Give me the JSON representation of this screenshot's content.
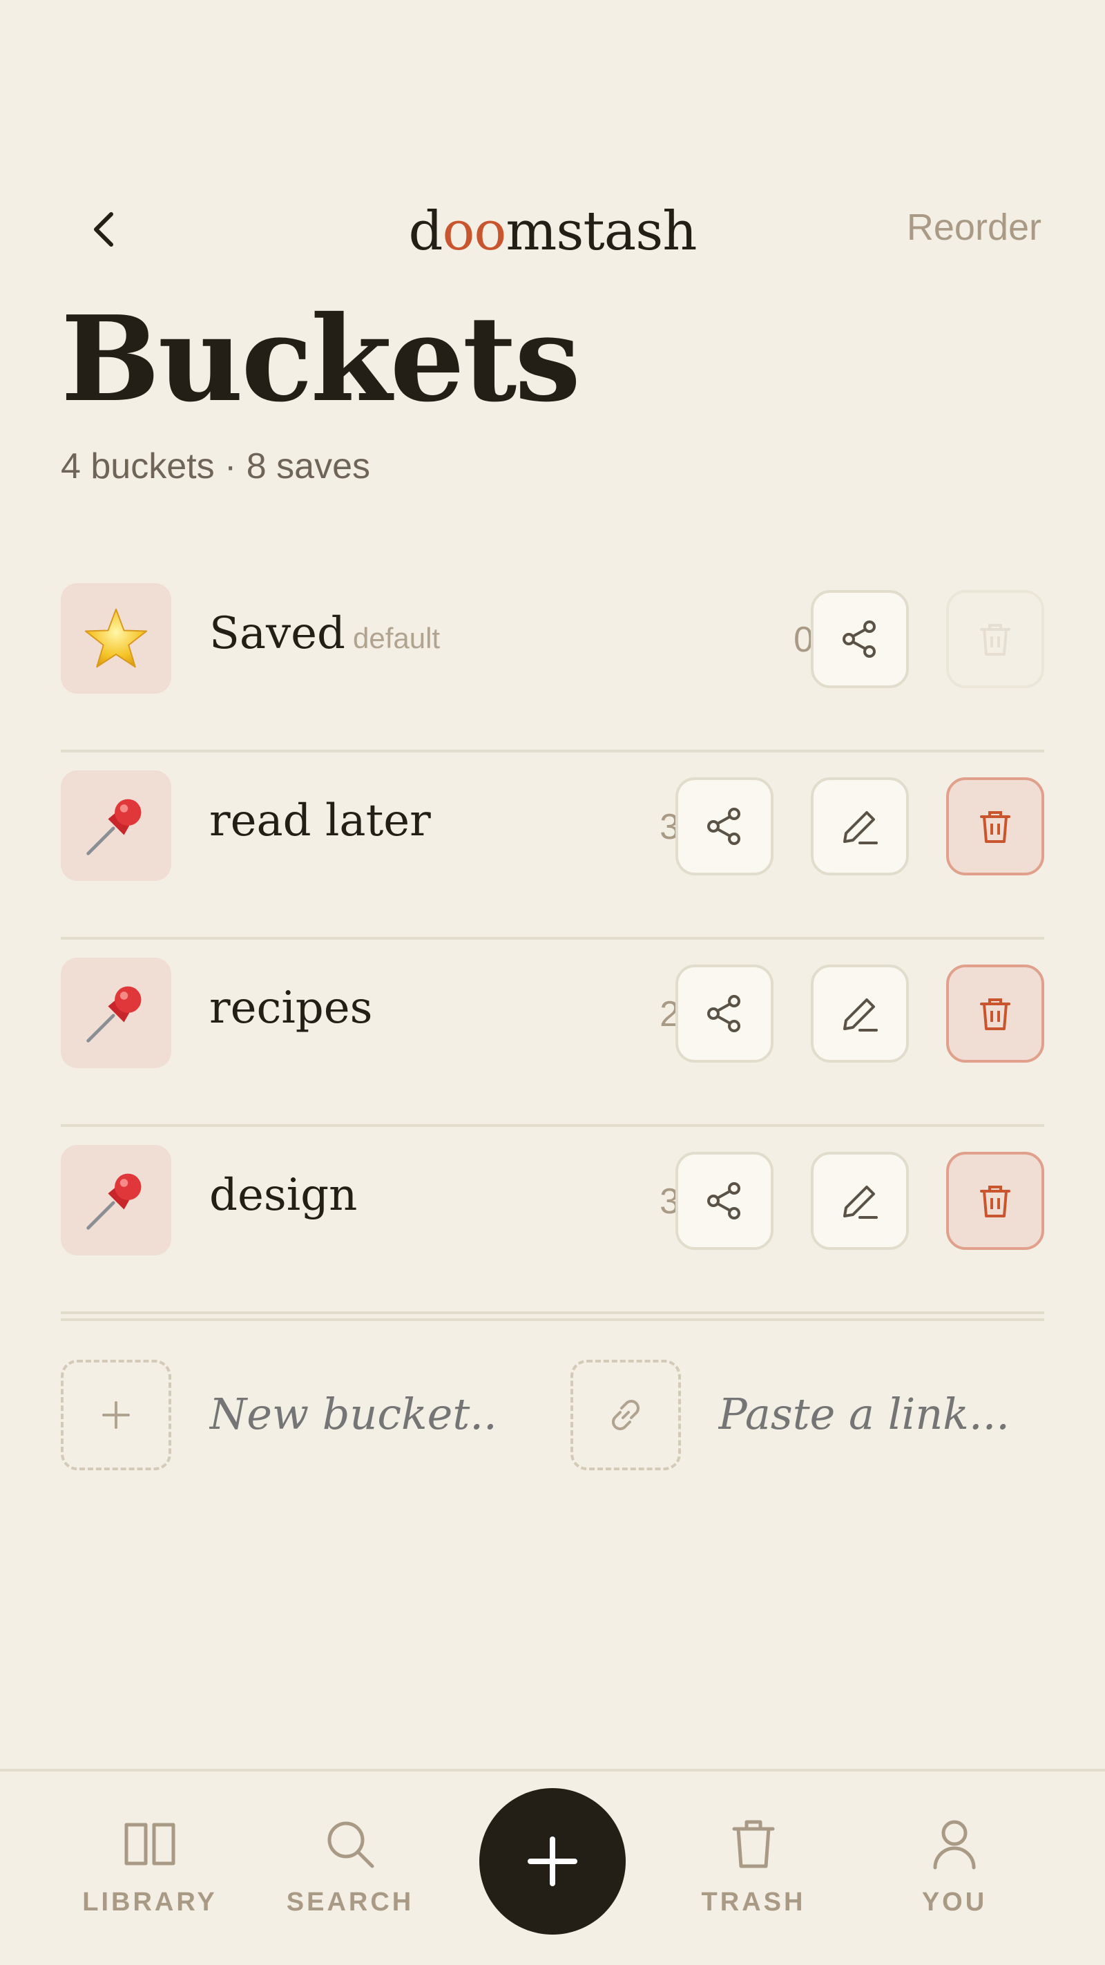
{
  "header": {
    "brand": "doomstash",
    "brand_parts": {
      "pre": "d",
      "oo": "oo",
      "post": "mstash"
    },
    "reorder_label": "Reorder"
  },
  "page": {
    "title": "Buckets",
    "subtitle": "4 buckets · 8 saves"
  },
  "buckets": [
    {
      "icon": "⭐",
      "icon_name": "star-icon",
      "name": "Saved",
      "badge": "default",
      "count": "0",
      "editable": false,
      "deletable": false
    },
    {
      "icon": "📌",
      "icon_name": "pushpin-icon",
      "name": "read later",
      "count": "3",
      "editable": true,
      "deletable": true
    },
    {
      "icon": "📌",
      "icon_name": "pushpin-icon",
      "name": "recipes",
      "count": "2",
      "editable": true,
      "deletable": true
    },
    {
      "icon": "📌",
      "icon_name": "pushpin-icon",
      "name": "design",
      "count": "3",
      "editable": true,
      "deletable": true
    }
  ],
  "add_row": {
    "new_bucket_placeholder": "New bucket...",
    "paste_link_placeholder": "Paste a link..."
  },
  "nav": {
    "library": "LIBRARY",
    "search": "SEARCH",
    "trash": "TRASH",
    "you": "YOU"
  },
  "colors": {
    "background": "#f4efe4",
    "accent": "#c8552e",
    "ink": "#231f17",
    "muted": "#a99a86"
  }
}
